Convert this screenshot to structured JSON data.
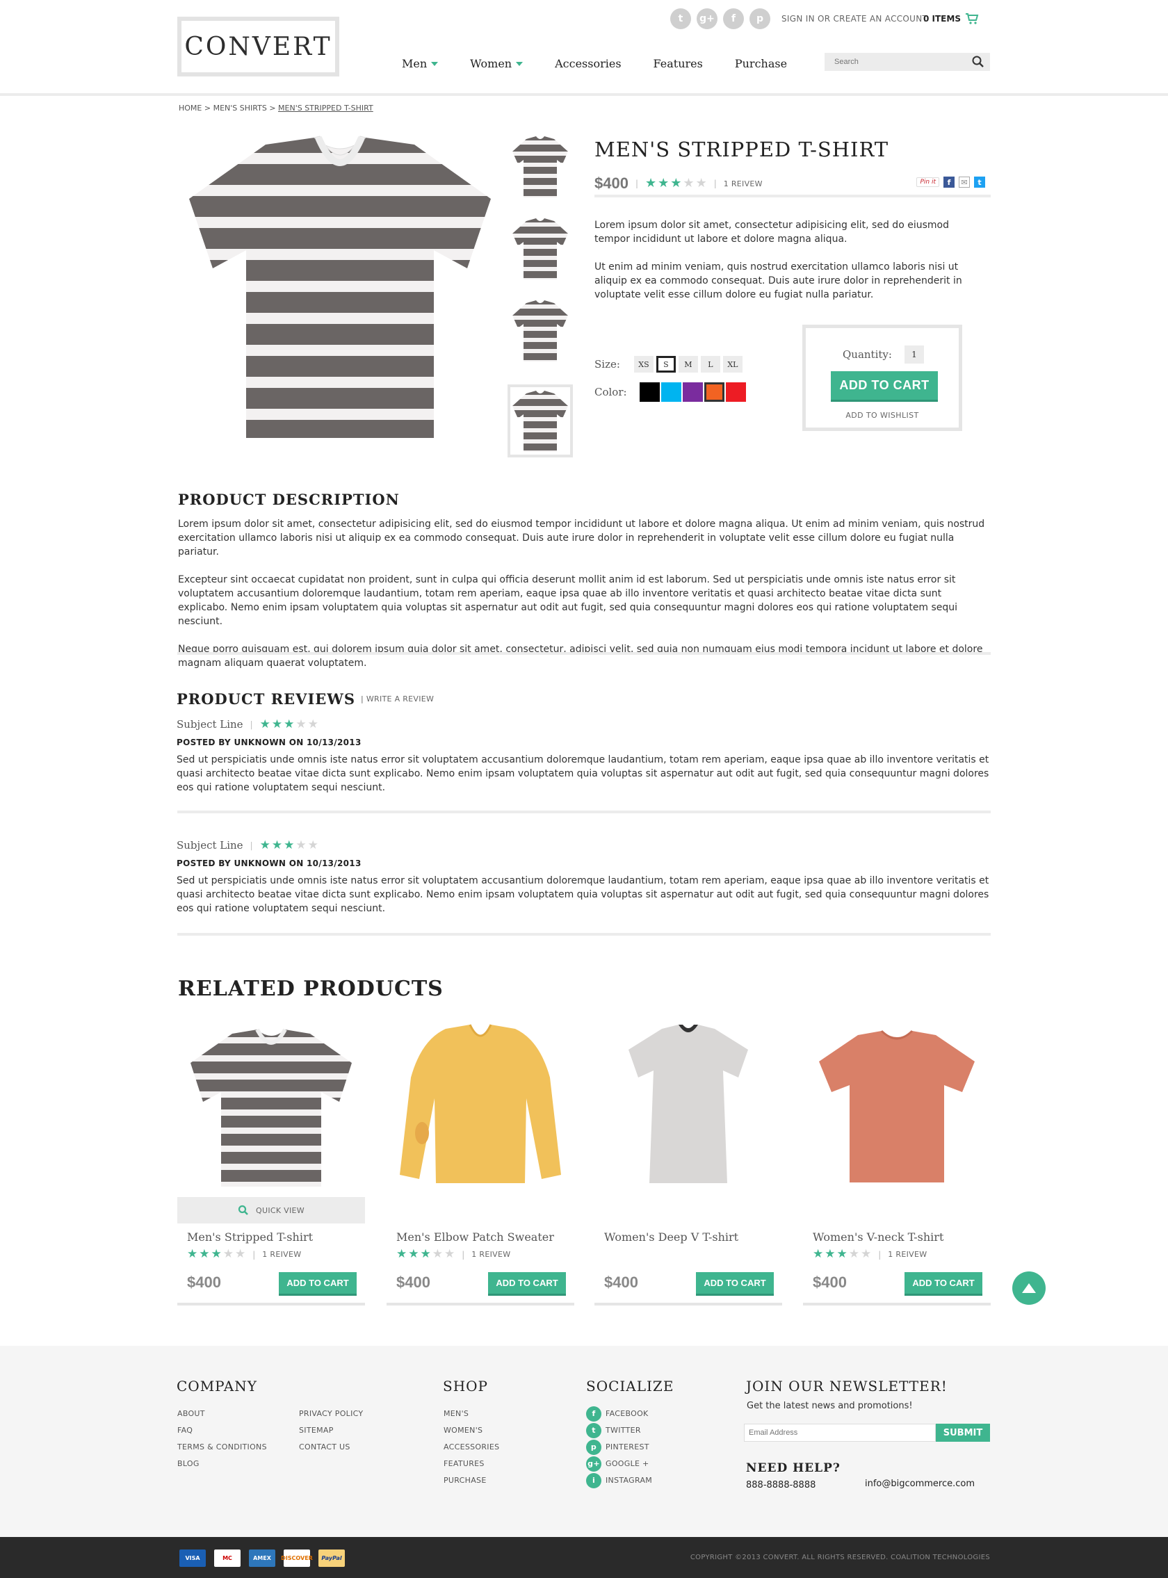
{
  "header": {
    "logo": "CONVERT",
    "account_link": "SIGN IN OR CREATE AN ACCOUNT",
    "cart_label": "0 ITEMS",
    "nav": [
      {
        "label": "Men",
        "dropdown": true
      },
      {
        "label": "Women",
        "dropdown": true
      },
      {
        "label": "Accessories",
        "dropdown": false
      },
      {
        "label": "Features",
        "dropdown": false
      },
      {
        "label": "Purchase",
        "dropdown": false
      }
    ],
    "search_placeholder": "Search",
    "social_icons": [
      "twitter-icon",
      "google-plus-icon",
      "facebook-icon",
      "pinterest-icon"
    ]
  },
  "breadcrumb": {
    "home": "HOME",
    "sep1": ">",
    "cat": "MEN'S SHIRTS",
    "sep2": ">",
    "current": "MEN'S STRIPPED T-SHIRT"
  },
  "product": {
    "title": "MEN'S STRIPPED T-SHIRT",
    "price": "$400",
    "rating": 3,
    "rating_max": 5,
    "reviews_count": "1 REIVEW",
    "pin_label": "Pin it",
    "description": [
      "Lorem ipsum dolor sit amet, consectetur adipisicing elit, sed do eiusmod tempor incididunt ut labore et dolore magna aliqua.",
      "Ut enim ad minim veniam, quis nostrud exercitation ullamco laboris nisi ut aliquip ex ea commodo consequat. Duis aute irure dolor in reprehenderit in voluptate velit esse cillum dolore eu fugiat nulla pariatur."
    ],
    "size_label": "Size:",
    "sizes": [
      "XS",
      "S",
      "M",
      "L",
      "XL"
    ],
    "selected_size": "S",
    "color_label": "Color:",
    "colors": [
      "#000000",
      "#00b4f0",
      "#7a2c9e",
      "#f26322",
      "#ed1c24"
    ],
    "selected_color": "#f26322",
    "quantity_label": "Quantity:",
    "quantity": "1",
    "add_to_cart": "ADD TO CART",
    "wishlist": "ADD TO WISHLIST"
  },
  "product_description": {
    "title": "PRODUCT DESCRIPTION",
    "paragraphs": [
      "Lorem ipsum dolor sit amet, consectetur adipisicing elit, sed do eiusmod tempor incididunt ut labore et dolore magna aliqua. Ut enim ad minim veniam, quis nostrud exercitation ullamco laboris nisi ut aliquip ex ea commodo consequat. Duis aute irure dolor in reprehenderit in voluptate velit esse cillum dolore eu fugiat nulla pariatur.",
      "Excepteur sint occaecat cupidatat non proident, sunt in culpa qui officia deserunt mollit anim id est laborum. Sed ut perspiciatis unde omnis iste natus error sit voluptatem accusantium doloremque laudantium, totam rem aperiam, eaque ipsa quae ab illo inventore veritatis et quasi architecto beatae vitae dicta sunt explicabo. Nemo enim ipsam voluptatem quia voluptas sit aspernatur aut odit aut fugit, sed quia consequuntur magni dolores eos qui ratione voluptatem sequi nesciunt.",
      "Neque porro quisquam est, qui dolorem ipsum quia dolor sit amet, consectetur, adipisci velit, sed quia non numquam eius modi tempora incidunt ut labore et dolore magnam aliquam quaerat voluptatem."
    ]
  },
  "reviews": {
    "title": "PRODUCT REVIEWS",
    "write_link": "WRITE A REVIEW",
    "items": [
      {
        "subject": "Subject Line",
        "rating": 3,
        "posted_by": "POSTED BY UNKNOWN ON 10/13/2013",
        "body": "Sed ut perspiciatis unde omnis iste natus error sit voluptatem accusantium doloremque laudantium, totam rem aperiam, eaque ipsa quae ab illo inventore veritatis et quasi architecto beatae vitae dicta sunt explicabo. Nemo enim ipsam voluptatem quia voluptas sit aspernatur aut odit aut fugit, sed quia consequuntur magni dolores eos qui ratione voluptatem sequi nesciunt."
      },
      {
        "subject": "Subject Line",
        "rating": 3,
        "posted_by": "POSTED BY UNKNOWN ON 10/13/2013",
        "body": "Sed ut perspiciatis unde omnis iste natus error sit voluptatem accusantium doloremque laudantium, totam rem aperiam, eaque ipsa quae ab illo inventore veritatis et quasi architecto beatae vitae dicta sunt explicabo. Nemo enim ipsam voluptatem quia voluptas sit aspernatur aut odit aut fugit, sed quia consequuntur magni dolores eos qui ratione voluptatem sequi nesciunt."
      }
    ]
  },
  "related": {
    "title": "RELATED PRODUCTS",
    "quick_view": "QUICK VIEW",
    "items": [
      {
        "name": "Men's Stripped T-shirt",
        "rating": 3,
        "reviews": "1 REIVEW",
        "price": "$400",
        "button": "ADD TO CART",
        "image": "striped-tshirt"
      },
      {
        "name": "Men's Elbow Patch Sweater",
        "rating": 3,
        "reviews": "1 REIVEW",
        "price": "$400",
        "button": "ADD TO CART",
        "image": "yellow-sweater"
      },
      {
        "name": "Women's Deep V T-shirt",
        "rating": 0,
        "reviews": "",
        "price": "$400",
        "button": "ADD TO CART",
        "image": "grey-tshirt"
      },
      {
        "name": "Women's V-neck T-shirt",
        "rating": 3,
        "reviews": "1 REIVEW",
        "price": "$400",
        "button": "ADD TO CART",
        "image": "orange-tshirt"
      }
    ]
  },
  "footer": {
    "company": {
      "title": "COMPANY",
      "col1": [
        "ABOUT",
        "FAQ",
        "TERMS & CONDITIONS",
        "BLOG"
      ],
      "col2": [
        "PRIVACY POLICY",
        "SITEMAP",
        "CONTACT US"
      ]
    },
    "shop": {
      "title": "SHOP",
      "links": [
        "MEN'S",
        "WOMEN'S",
        "ACCESSORIES",
        "FEATURES",
        "PURCHASE"
      ]
    },
    "socialize": {
      "title": "SOCIALIZE",
      "links": [
        {
          "label": "FACEBOOK",
          "icon": "facebook-icon",
          "glyph": "f"
        },
        {
          "label": "TWITTER",
          "icon": "twitter-icon",
          "glyph": "t"
        },
        {
          "label": "PINTEREST",
          "icon": "pinterest-icon",
          "glyph": "p"
        },
        {
          "label": "GOOGLE +",
          "icon": "google-plus-icon",
          "glyph": "g+"
        },
        {
          "label": "INSTAGRAM",
          "icon": "instagram-icon",
          "glyph": "i"
        }
      ]
    },
    "newsletter": {
      "title": "JOIN OUR NEWSLETTER!",
      "subtitle": "Get the latest news and promotions!",
      "placeholder": "Email Address",
      "button": "SUBMIT"
    },
    "help": {
      "title": "NEED HELP?",
      "phone": "888-8888-8888",
      "email": "info@bigcommerce.com"
    },
    "copyright": "COPYRIGHT ©2013 CONVERT.  ALL RIGHTS RESERVED. COALITION TECHNOLOGIES",
    "payment_cards": [
      "VISA",
      "MC",
      "AMEX",
      "DISCOVER",
      "PayPal"
    ]
  },
  "colors": {
    "accent": "#3fb58f",
    "star_off": "#d5d5d5"
  }
}
